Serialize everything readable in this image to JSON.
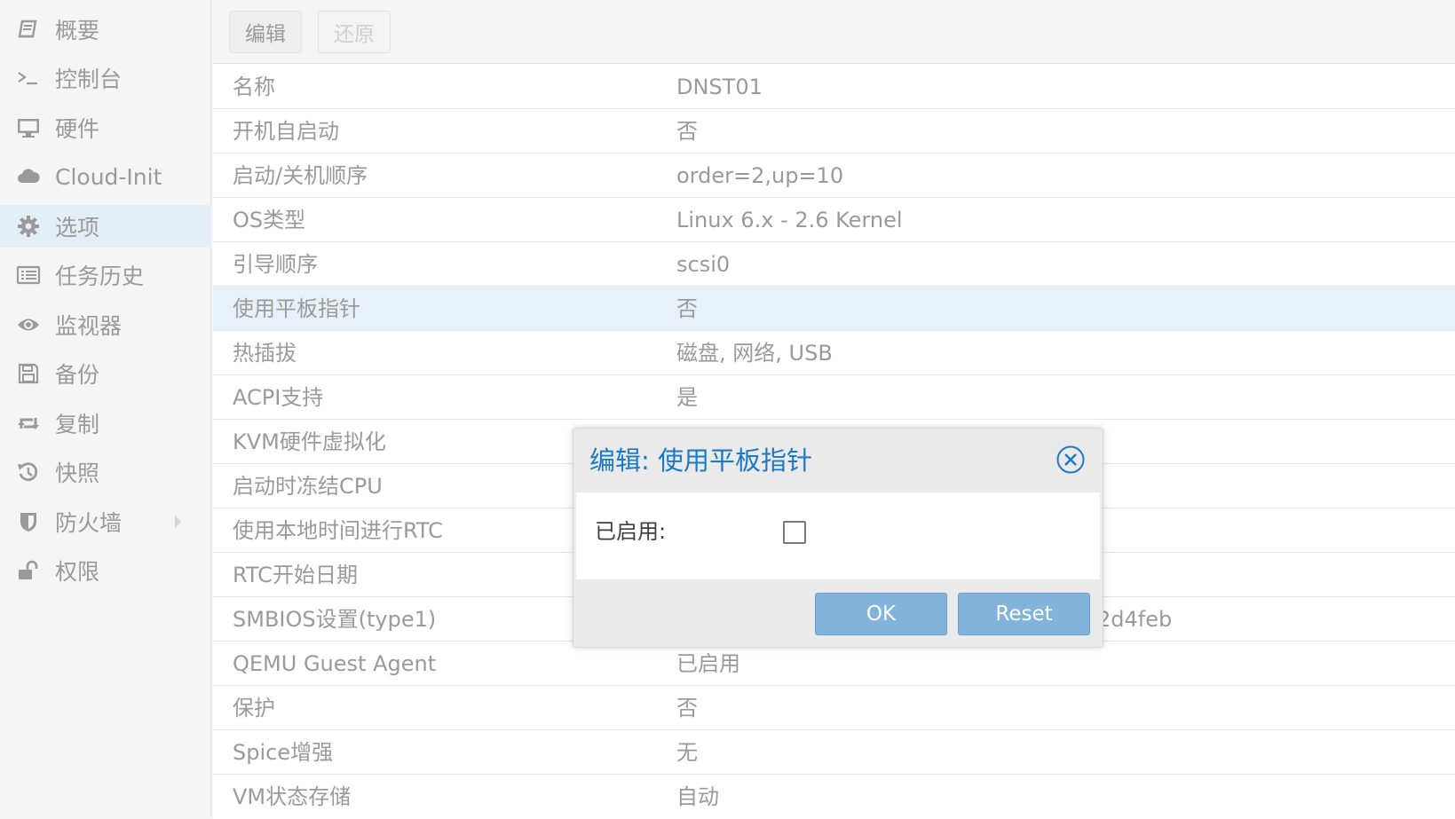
{
  "sidebar": {
    "items": [
      {
        "label": "概要",
        "icon": "book-icon"
      },
      {
        "label": "控制台",
        "icon": "terminal-icon"
      },
      {
        "label": "硬件",
        "icon": "monitor-icon"
      },
      {
        "label": "Cloud-Init",
        "icon": "cloud-icon"
      },
      {
        "label": "选项",
        "icon": "gear-icon",
        "active": true
      },
      {
        "label": "任务历史",
        "icon": "list-icon"
      },
      {
        "label": "监视器",
        "icon": "eye-icon"
      },
      {
        "label": "备份",
        "icon": "floppy-icon"
      },
      {
        "label": "复制",
        "icon": "retweet-icon"
      },
      {
        "label": "快照",
        "icon": "history-icon"
      },
      {
        "label": "防火墙",
        "icon": "shield-icon"
      },
      {
        "label": "权限",
        "icon": "unlock-icon"
      }
    ]
  },
  "toolbar": {
    "edit_label": "编辑",
    "revert_label": "还原"
  },
  "options": [
    {
      "key": "名称",
      "value": "DNST01"
    },
    {
      "key": "开机自启动",
      "value": "否"
    },
    {
      "key": "启动/关机顺序",
      "value": "order=2,up=10"
    },
    {
      "key": "OS类型",
      "value": "Linux 6.x - 2.6 Kernel"
    },
    {
      "key": "引导顺序",
      "value": "scsi0"
    },
    {
      "key": "使用平板指针",
      "value": "否"
    },
    {
      "key": "热插拔",
      "value": "磁盘, 网络, USB"
    },
    {
      "key": "ACPI支持",
      "value": "是"
    },
    {
      "key": "KVM硬件虚拟化",
      "value": ""
    },
    {
      "key": "启动时冻结CPU",
      "value": ""
    },
    {
      "key": "使用本地时间进行RTC",
      "value": ""
    },
    {
      "key": "RTC开始日期",
      "value": ""
    },
    {
      "key": "SMBIOS设置(type1)",
      "value": "2d4feb"
    },
    {
      "key": "QEMU Guest Agent",
      "value": "已启用"
    },
    {
      "key": "保护",
      "value": "否"
    },
    {
      "key": "Spice增强",
      "value": "无"
    },
    {
      "key": "VM状态存储",
      "value": "自动"
    }
  ],
  "dialog": {
    "title": "编辑: 使用平板指针",
    "field_label": "已启用:",
    "enabled_checked": false,
    "ok_label": "OK",
    "reset_label": "Reset"
  },
  "colors": {
    "accent": "#1a7ac8",
    "button": "#82b3db",
    "selected_row": "#e9f1f8",
    "sidebar_active": "#e3eef6"
  }
}
